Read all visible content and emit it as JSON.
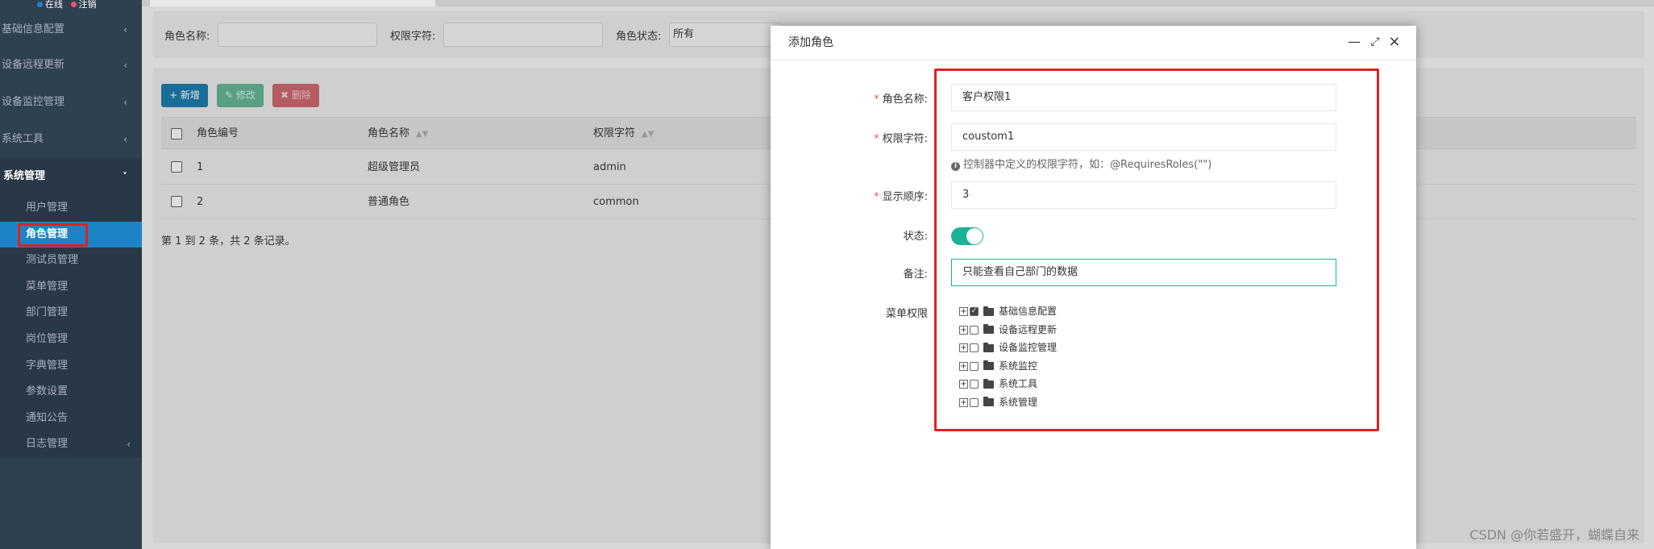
{
  "sidebar": {
    "status": {
      "online": "在线",
      "logout": "注销"
    },
    "menu": [
      {
        "label": "基础信息配置"
      },
      {
        "label": "设备远程更新"
      },
      {
        "label": "设备监控管理"
      },
      {
        "label": "系统工具"
      },
      {
        "label": "系统管理"
      }
    ],
    "submenu": [
      {
        "label": "用户管理"
      },
      {
        "label": "角色管理"
      },
      {
        "label": "测试员管理"
      },
      {
        "label": "菜单管理"
      },
      {
        "label": "部门管理"
      },
      {
        "label": "岗位管理"
      },
      {
        "label": "字典管理"
      },
      {
        "label": "参数设置"
      },
      {
        "label": "通知公告"
      },
      {
        "label": "日志管理"
      }
    ]
  },
  "search": {
    "role_name_label": "角色名称:",
    "perm_label": "权限字符:",
    "status_label": "角色状态:",
    "status_value": "所有"
  },
  "toolbar": {
    "add": "新增",
    "edit": "修改",
    "delete": "删除"
  },
  "table": {
    "headers": [
      "角色编号",
      "角色名称",
      "权限字符"
    ],
    "rows": [
      {
        "id": "1",
        "name": "超级管理员",
        "key": "admin"
      },
      {
        "id": "2",
        "name": "普通角色",
        "key": "common"
      }
    ],
    "pager": "第 1 到 2 条，共 2 条记录。"
  },
  "modal": {
    "title": "添加角色",
    "role_name_label": "角色名称:",
    "role_name_value": "客户权限1",
    "perm_label": "权限字符:",
    "perm_value": "coustom1",
    "perm_hint": "控制器中定义的权限字符，如：@RequiresRoles(\"\")",
    "order_label": "显示顺序:",
    "order_value": "3",
    "status_label": "状态:",
    "status_on": true,
    "remark_label": "备注:",
    "remark_value": "只能查看自己部门的数据",
    "menu_perm_label": "菜单权限",
    "tree": [
      {
        "label": "基础信息配置",
        "checked": true
      },
      {
        "label": "设备远程更新",
        "checked": false
      },
      {
        "label": "设备监控管理",
        "checked": false
      },
      {
        "label": "系统监控",
        "checked": false
      },
      {
        "label": "系统工具",
        "checked": false
      },
      {
        "label": "系统管理",
        "checked": false
      }
    ]
  },
  "watermark": "CSDN @你若盛开，蝴蝶自来",
  "colors": {
    "accent": "#1ab394",
    "highlight_border": "#e02020",
    "sidebar_bg": "#2f4050",
    "active_item": "#1c84c6"
  }
}
